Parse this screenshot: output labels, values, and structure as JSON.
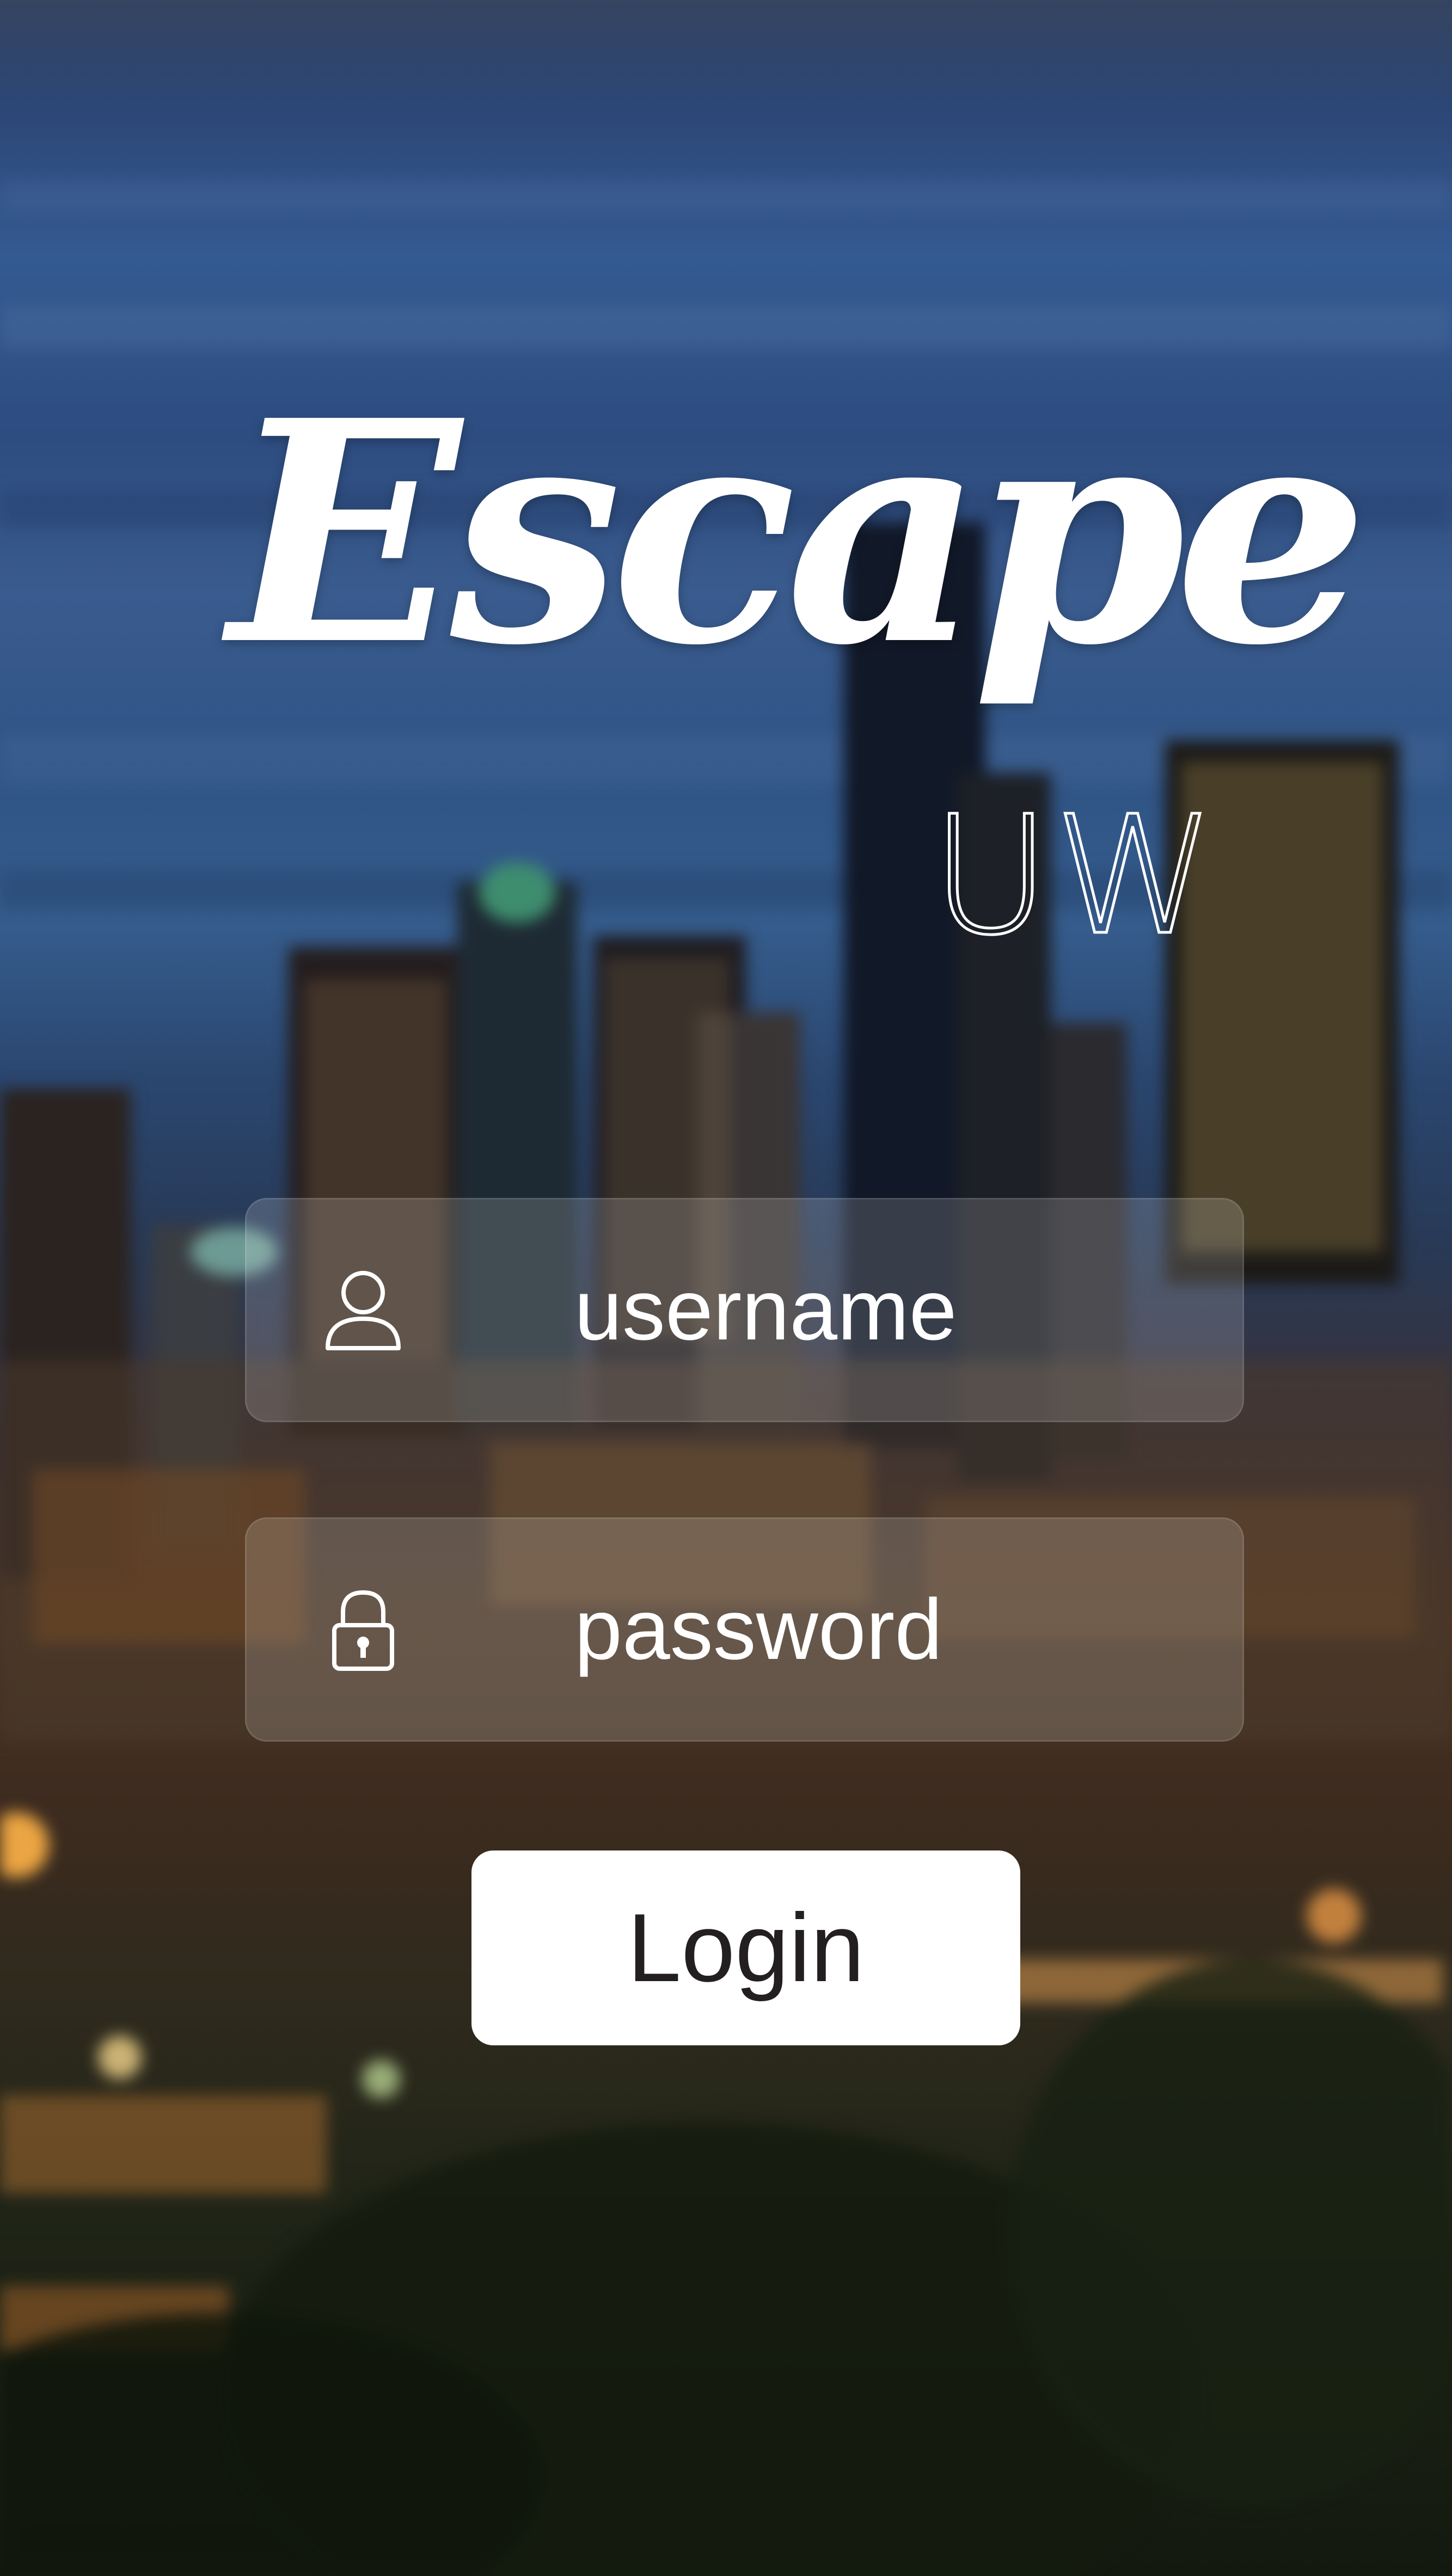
{
  "app": {
    "logo_script": "Escape",
    "logo_sub": "UW"
  },
  "form": {
    "username": {
      "placeholder": "username",
      "icon": "user-icon"
    },
    "password": {
      "placeholder": "password",
      "icon": "lock-icon"
    },
    "login_label": "Login"
  },
  "colors": {
    "text": "#ffffff",
    "button_bg": "#ffffff",
    "button_text": "#231f20"
  }
}
